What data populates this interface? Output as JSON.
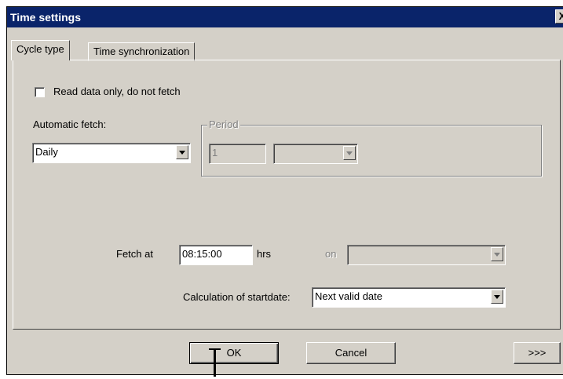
{
  "dialog": {
    "title": "Time settings",
    "close_glyph": "X"
  },
  "tabs": [
    {
      "label": "Cycle type",
      "active": true
    },
    {
      "label": "Time synchronization",
      "active": false
    }
  ],
  "read_only": {
    "label": "Read data only, do not fetch",
    "checked": false
  },
  "auto_fetch": {
    "label": "Automatic fetch:",
    "value": "Daily"
  },
  "period": {
    "legend": "Period",
    "count": "1",
    "unit": ""
  },
  "fetch_at": {
    "label": "Fetch at",
    "value": "08:15:00",
    "unit": "hrs",
    "on_label": "on",
    "on_value": ""
  },
  "startdate": {
    "label": "Calculation of startdate:",
    "value": "Next valid date"
  },
  "buttons": {
    "ok": "OK",
    "cancel": "Cancel",
    "more": ">>>"
  }
}
